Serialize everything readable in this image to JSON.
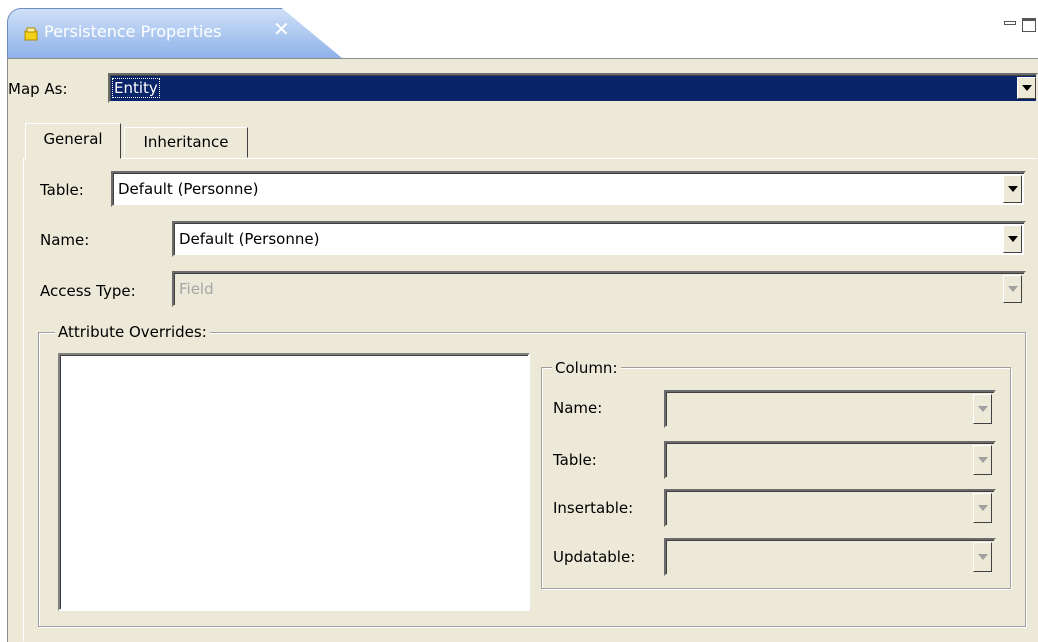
{
  "view_tab": {
    "title": "Persistence Properties",
    "close_glyph": "✕",
    "icon": "persistence-properties-icon"
  },
  "map_as": {
    "label": "Map As:",
    "value": "Entity"
  },
  "tabs": [
    {
      "label": "General",
      "active": true
    },
    {
      "label": "Inheritance",
      "active": false
    }
  ],
  "general": {
    "table": {
      "label": "Table:",
      "value": "Default (Personne)"
    },
    "name": {
      "label": "Name:",
      "value": "Default (Personne)"
    },
    "access_type": {
      "label": "Access Type:",
      "value": "Field",
      "enabled": false
    }
  },
  "attribute_overrides": {
    "title": "Attribute Overrides:",
    "column": {
      "title": "Column:",
      "fields": [
        {
          "label": "Name:",
          "value": ""
        },
        {
          "label": "Table:",
          "value": ""
        },
        {
          "label": "Insertable:",
          "value": ""
        },
        {
          "label": "Updatable:",
          "value": ""
        }
      ]
    }
  },
  "colors": {
    "tab_gradient_top": "#cfe0f8",
    "tab_gradient_bottom": "#8fb2e8",
    "panel_bg": "#ece9d8",
    "selection": "#0a246a"
  }
}
